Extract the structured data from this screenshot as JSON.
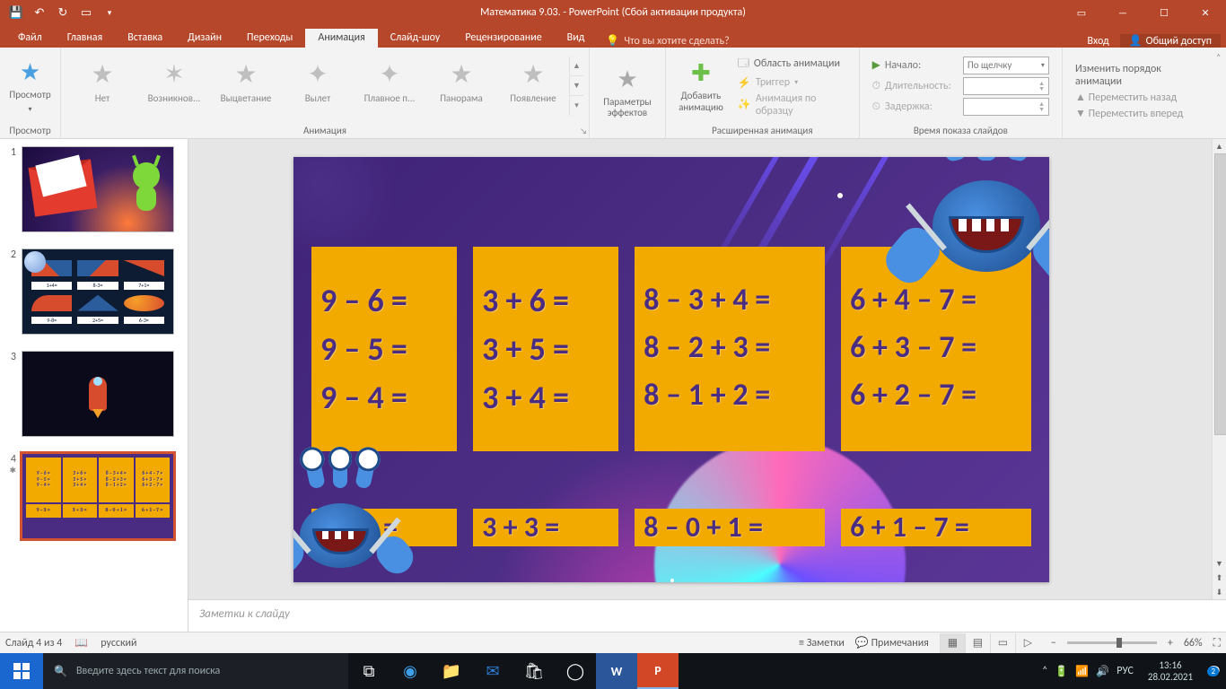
{
  "titlebar": {
    "title": "Математика 9.03. - PowerPoint (Сбой активации продукта)"
  },
  "ribbon_tabs": {
    "file": "Файл",
    "home": "Главная",
    "insert": "Вставка",
    "design": "Дизайн",
    "transitions": "Переходы",
    "animations": "Анимация",
    "slideshow": "Слайд-шоу",
    "review": "Рецензирование",
    "view": "Вид",
    "tell_me": "Что вы хотите сделать?",
    "login": "Вход",
    "share": "Общий доступ"
  },
  "ribbon": {
    "preview": {
      "label": "Просмотр",
      "btn": "Просмотр"
    },
    "animation": {
      "label": "Анимация",
      "items": [
        "Нет",
        "Возникнов...",
        "Выцветание",
        "Вылет",
        "Плавное п...",
        "Панорама",
        "Появление"
      ]
    },
    "effect_options": "Параметры\nэффектов",
    "add_animation": "Добавить\nанимацию",
    "advanced": {
      "label": "Расширенная анимация",
      "pane": "Область анимации",
      "trigger": "Триггер",
      "painter": "Анимация по образцу"
    },
    "timing": {
      "label": "Время показа слайдов",
      "start": "Начало:",
      "start_value": "По щелчку",
      "duration": "Длительность:",
      "delay": "Задержка:"
    },
    "reorder": {
      "label": "Изменить порядок анимации",
      "earlier": "Переместить назад",
      "later": "Переместить вперед"
    }
  },
  "thumbs": {
    "s2_labels": [
      "1+4=",
      "8-3=",
      "7+1=",
      "9-8=",
      "2+5=",
      "6-3="
    ]
  },
  "slide": {
    "col1": [
      "9 – 6 =",
      "9 – 5 =",
      "9 – 4 ="
    ],
    "col2": [
      "3 + 6 =",
      "3 + 5 =",
      "3 + 4 ="
    ],
    "col3": [
      "8 – 3 + 4 =",
      "8 – 2 + 3 =",
      "8 – 1 + 2 ="
    ],
    "col4": [
      "6 + 4 – 7 =",
      "6 + 3 – 7 =",
      "6 + 2 – 7 ="
    ],
    "bot": [
      "9 – 3 =",
      "3 + 3 =",
      "8 – 0 + 1 =",
      "6 + 1 – 7 ="
    ]
  },
  "notes": {
    "placeholder": "Заметки к слайду"
  },
  "status": {
    "slide": "Слайд 4 из 4",
    "lang": "русский",
    "notes_btn": "Заметки",
    "comments_btn": "Примечания",
    "zoom": "66%"
  },
  "taskbar": {
    "search_placeholder": "Введите здесь текст для поиска",
    "lang": "РУС",
    "time": "13:16",
    "date": "28.02.2021"
  }
}
